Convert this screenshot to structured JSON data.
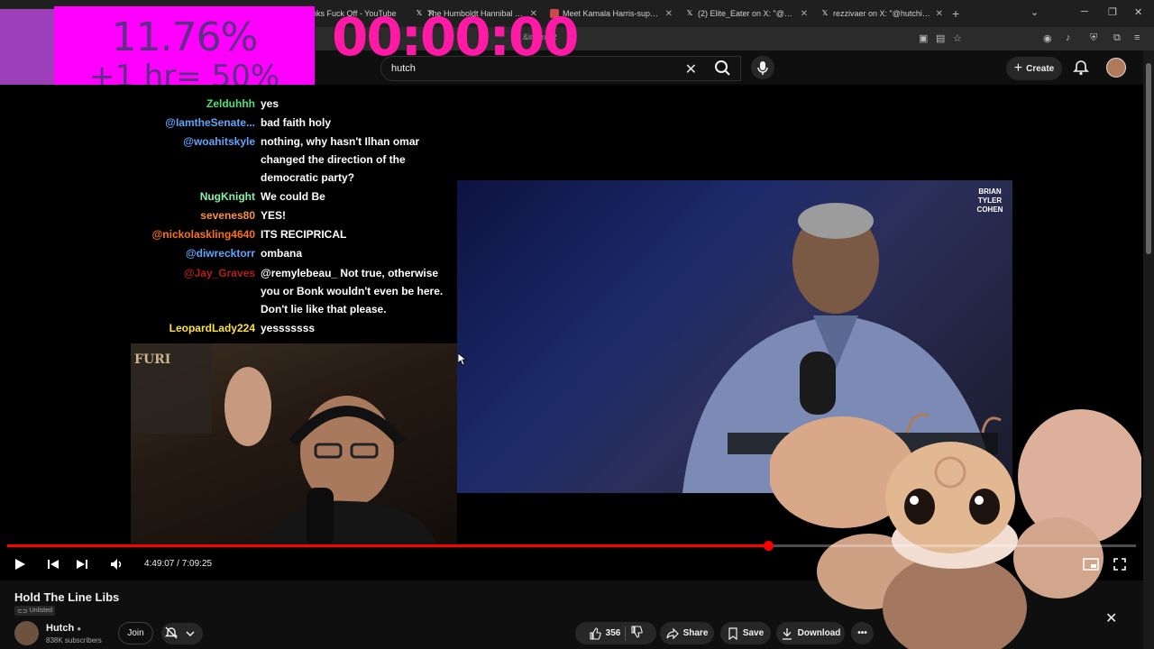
{
  "browser": {
    "tabs": [
      {
        "title": "nks Fuck Off - YouTube",
        "icon": "youtube-icon"
      },
      {
        "title": "The Humboldt Hannibal on X",
        "icon": "x-logo-icon"
      },
      {
        "title": "Meet Kamala Harris-supporting",
        "icon": "page-icon"
      },
      {
        "title": "(2) Elite_Eater on X: \"@hutchins",
        "icon": "x-logo-icon"
      },
      {
        "title": "rezzivaer on X: \"@hutchinson @",
        "icon": "x-logo-icon"
      }
    ],
    "url_fragment": "&index=2"
  },
  "overlay": {
    "percent": "11.76%",
    "subline": "+1 hr= 50%",
    "timer": "00:00:00"
  },
  "search": {
    "query": "hutch"
  },
  "header": {
    "create_label": "Create"
  },
  "chat": [
    {
      "user": "Zelduhhh",
      "text": "yes",
      "color": "#4ade80",
      "badges": 2
    },
    {
      "user": "@IamtheSenate...",
      "text": "bad faith holy",
      "color": "#60a5fa",
      "badges": 1
    },
    {
      "user": "@woahitskyle",
      "text": "nothing, why hasn't Ilhan omar changed the direction of the democratic party?",
      "color": "#60a5fa",
      "badges": 0
    },
    {
      "user": "NugKnight",
      "text": "We could Be",
      "color": "#86efac",
      "badges": 1
    },
    {
      "user": "sevenes80",
      "text": "YES!",
      "color": "#fb923c",
      "badges": 1
    },
    {
      "user": "@nickolaskling4640",
      "text": "ITS RECIPRICAL",
      "color": "#f97316",
      "badges": 0
    },
    {
      "user": "@diwrecktorr",
      "text": "ombana",
      "color": "#60a5fa",
      "badges": 0
    },
    {
      "user": "@Jay_Graves",
      "text": "@remylebeau_ Not true, otherwise you or Bonk wouldn't even be here. Don't lie like that please.",
      "color": "#b91c1c",
      "badges": 2
    },
    {
      "user": "LeopardLady224",
      "text": "yesssssss",
      "color": "#fde047",
      "badges": 0
    }
  ],
  "clip": {
    "watermark": "BRIAN TYLER COHEN"
  },
  "webcam": {
    "sign": "FURI"
  },
  "player": {
    "current_time": "4:49:07",
    "duration": "7:09:25",
    "progress": 0.674
  },
  "video": {
    "title": "Hold The Line Libs",
    "visibility": "Unlisted",
    "channel": "Hutch",
    "subscribers": "838K subscribers"
  },
  "actions": {
    "join": "Join",
    "likes": "356",
    "share": "Share",
    "save": "Save",
    "download": "Download"
  },
  "colors": {
    "accent": "#ff0000",
    "overlay_bg": "#ff00ff",
    "timer": "#ff1aa6"
  }
}
